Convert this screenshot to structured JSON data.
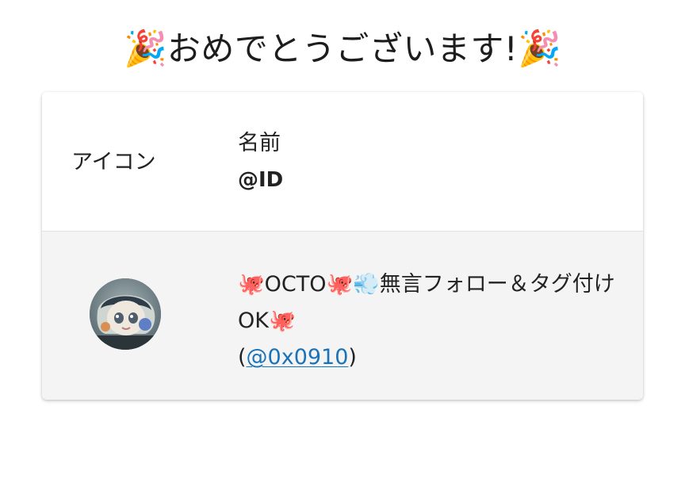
{
  "heading": {
    "text": "おめでとうございます!",
    "left_emoji": "🎉",
    "right_emoji": "🎉"
  },
  "table": {
    "headers": {
      "icon": "アイコン",
      "name": "名前",
      "id": "@ID"
    },
    "rows": [
      {
        "avatar": "user-avatar",
        "name": "🐙OCTO🐙💨無言フォロー＆タグ付けOK🐙",
        "handle_prefix": "(",
        "handle": "@0x0910",
        "handle_suffix": ")"
      }
    ]
  }
}
